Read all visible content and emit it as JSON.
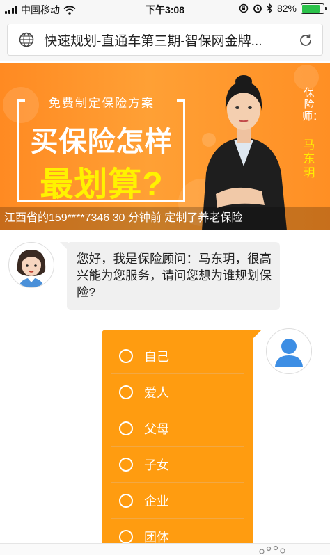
{
  "status_bar": {
    "carrier": "中国移动",
    "time": "下午3:08",
    "battery_percent": "82%",
    "battery_level": 0.82,
    "icons": [
      "signal-icon",
      "wifi-icon",
      "orientation-lock-icon",
      "alarm-icon",
      "bluetooth-icon",
      "battery-icon"
    ]
  },
  "browser": {
    "title": "快速规划-直通车第三期-智保网金牌...",
    "icons": [
      "globe-icon",
      "reload-icon"
    ]
  },
  "banner": {
    "small_title": "免费制定保险方案",
    "headline_1": "买保险怎样",
    "headline_2": "最划算?",
    "adviser_label": "保险师：",
    "adviser_name": "马东玥",
    "ticker": "江西省的159****7346 30 分钟前 定制了养老保险",
    "colors": {
      "bg": "#ff8f24",
      "highlight": "#fff200"
    }
  },
  "chat": {
    "greeting": "您好，我是保险顾问：马东玥，很高兴能为您服务，请问您想为谁规划保险?",
    "options": [
      "自己",
      "爱人",
      "父母",
      "子女",
      "企业",
      "团体"
    ],
    "colors": {
      "options_bg": "#ff9c10",
      "bubble_bg": "#f0f0f0"
    }
  }
}
